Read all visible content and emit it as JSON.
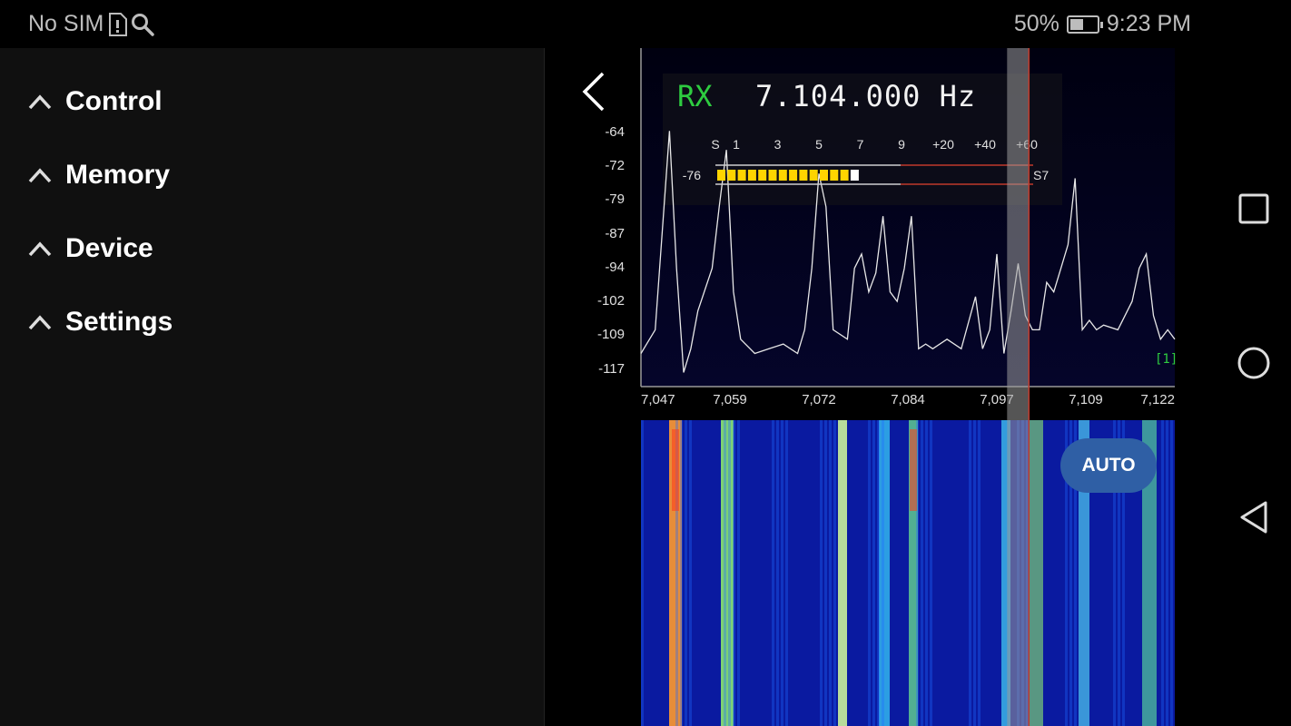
{
  "status_bar": {
    "carrier": "No SIM",
    "battery_percent": "50%",
    "battery_level": 0.5,
    "time": "9:23 PM"
  },
  "drawer": {
    "items": [
      {
        "label": "Control",
        "icon": "chevron-up-icon"
      },
      {
        "label": "Memory",
        "icon": "chevron-up-icon"
      },
      {
        "label": "Device",
        "icon": "chevron-up-icon"
      },
      {
        "label": "Settings",
        "icon": "chevron-up-icon"
      }
    ]
  },
  "radio": {
    "mode": "RX",
    "frequency": "7.104.000 Hz",
    "auto_label": "AUTO",
    "channel_marker": "[1]"
  },
  "colors": {
    "rx_green": "#2ecc40",
    "meter_yellow": "#ffd400",
    "marker_red": "#c0392b",
    "auto_blue": "#2f5fa5",
    "plot_bg": "#00001f"
  },
  "smeter": {
    "scale": [
      "S",
      "1",
      "3",
      "5",
      "7",
      "9",
      "+20",
      "+40",
      "+60"
    ],
    "db_value": "-76",
    "s_reading": "S7",
    "segments": 14
  },
  "chart_data": {
    "type": "line",
    "x_ticks": [
      "7,047",
      "7,059",
      "7,072",
      "7,084",
      "7,097",
      "7,109",
      "7,122"
    ],
    "y_ticks": [
      "-64",
      "-72",
      "-79",
      "-87",
      "-94",
      "-102",
      "-109",
      "-117"
    ],
    "xlim": [
      7047,
      7122
    ],
    "ylim": [
      -120,
      -60
    ],
    "x": [
      7047,
      7049,
      7051,
      7052,
      7053,
      7054,
      7055,
      7057,
      7058,
      7059,
      7060,
      7061,
      7063,
      7065,
      7067,
      7069,
      7070,
      7071,
      7072,
      7073,
      7074,
      7076,
      7077,
      7078,
      7079,
      7080,
      7081,
      7082,
      7083,
      7084,
      7085,
      7086,
      7087,
      7088,
      7090,
      7092,
      7094,
      7095,
      7096,
      7097,
      7098,
      7099,
      7100,
      7101,
      7102,
      7103,
      7104,
      7105,
      7106,
      7107,
      7108,
      7109,
      7110,
      7111,
      7112,
      7114,
      7116,
      7117,
      7118,
      7119,
      7120,
      7121,
      7122
    ],
    "y": [
      -113,
      -108,
      -66,
      -95,
      -117,
      -112,
      -104,
      -95,
      -82,
      -70,
      -100,
      -110,
      -113,
      -112,
      -111,
      -113,
      -108,
      -95,
      -75,
      -82,
      -108,
      -110,
      -95,
      -92,
      -100,
      -96,
      -84,
      -100,
      -102,
      -95,
      -84,
      -112,
      -111,
      -112,
      -110,
      -112,
      -101,
      -112,
      -108,
      -92,
      -113,
      -104,
      -94,
      -105,
      -108,
      -108,
      -98,
      -100,
      -95,
      -90,
      -76,
      -108,
      -106,
      -108,
      -107,
      -108,
      -102,
      -95,
      -92,
      -105,
      -110,
      -108,
      -110
    ],
    "marker_x": 7101.5
  }
}
